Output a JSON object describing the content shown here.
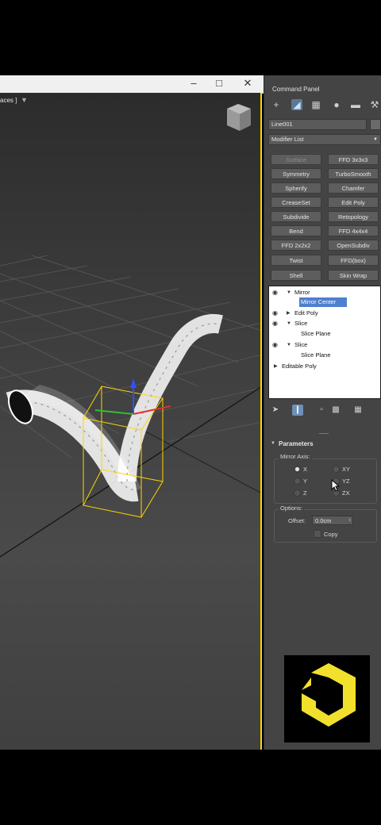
{
  "viewport": {
    "label": "aces ]",
    "filter_icon": "funnel-icon",
    "viewcube_icon": "viewcube-icon"
  },
  "window": {
    "minimize_icon": "minimize-icon",
    "maximize_icon": "maximize-icon",
    "close_icon": "close-icon"
  },
  "panel": {
    "title": "Command Panel",
    "tabs": [
      "plus-icon",
      "modify-icon",
      "hierarchy-icon",
      "motion-icon",
      "display-icon",
      "utilities-icon"
    ],
    "object_name": "Line001",
    "modifier_list": "Modifier List",
    "modifier_buttons": [
      [
        "Surface",
        "FFD 3x3x3"
      ],
      [
        "Symmetry",
        "TurboSmooth"
      ],
      [
        "Spherify",
        "Chamfer"
      ],
      [
        "CreaseSet",
        "Edit Poly"
      ],
      [
        "Subdivide",
        "Retopology"
      ],
      [
        "Bend",
        "FFD 4x4x4"
      ],
      [
        "FFD 2x2x2",
        "OpenSubdiv"
      ],
      [
        "Twist",
        "FFD(box)"
      ],
      [
        "Shell",
        "Skin Wrap"
      ]
    ],
    "stack": [
      {
        "label": "Mirror"
      },
      {
        "label": "Mirror Center"
      },
      {
        "label": "Edit Poly"
      },
      {
        "label": "Slice"
      },
      {
        "label": "Slice Plane"
      },
      {
        "label": "Slice"
      },
      {
        "label": "Slice Plane"
      },
      {
        "label": "Editable Poly"
      }
    ],
    "parameters": {
      "title": "Parameters",
      "mirror_axis_label": "Mirror Axis:",
      "axes": [
        "X",
        "XY",
        "Y",
        "YZ",
        "Z",
        "ZX"
      ],
      "selected_axis": "X",
      "options_label": "Options:",
      "offset_label": "Offset:",
      "offset_value": "0.0cm",
      "copy_label": "Copy"
    }
  },
  "colors": {
    "selection_yellow": "#ffd400",
    "stack_highlight": "#4f7fcf",
    "logo_yellow": "#f2e12c"
  }
}
